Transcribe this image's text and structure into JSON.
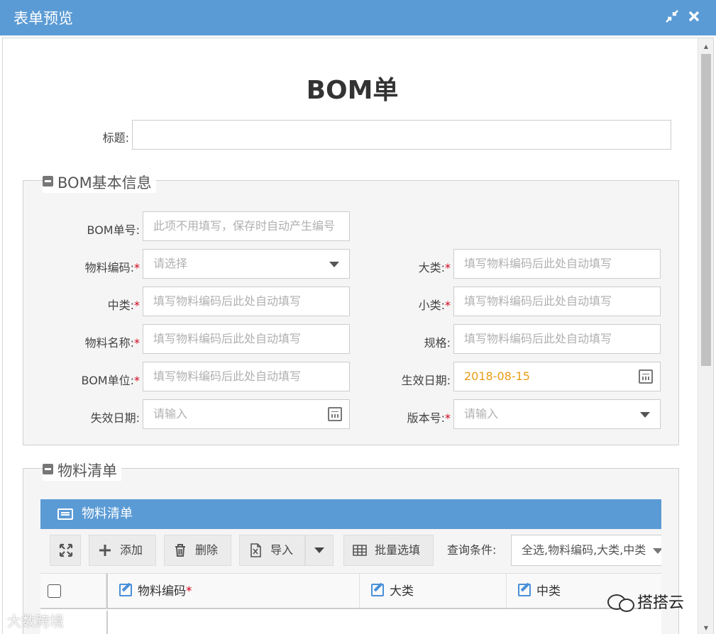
{
  "window": {
    "title": "表单预览"
  },
  "form": {
    "heading": "BOM单",
    "title_label": "标题:",
    "title_value": ""
  },
  "basic_section": {
    "legend": "BOM基本信息",
    "fields": {
      "bom_no": {
        "label": "BOM单号:",
        "placeholder": "此项不用填写，保存时自动产生编号"
      },
      "material_code": {
        "label": "物料编码:",
        "required": "*",
        "value": "请选择"
      },
      "category_l": {
        "label": "大类:",
        "required": "*",
        "placeholder": "填写物料编码后此处自动填写"
      },
      "category_m": {
        "label": "中类:",
        "required": "*",
        "placeholder": "填写物料编码后此处自动填写"
      },
      "category_s": {
        "label": "小类:",
        "required": "*",
        "placeholder": "填写物料编码后此处自动填写"
      },
      "material_name": {
        "label": "物料名称:",
        "required": "*",
        "placeholder": "填写物料编码后此处自动填写"
      },
      "spec": {
        "label": "规格:",
        "placeholder": "填写物料编码后此处自动填写"
      },
      "bom_unit": {
        "label": "BOM单位:",
        "required": "*",
        "placeholder": "填写物料编码后此处自动填写"
      },
      "effective_date": {
        "label": "生效日期:",
        "value": "2018-08-15"
      },
      "expiry_date": {
        "label": "失效日期:",
        "placeholder": "请输入"
      },
      "version": {
        "label": "版本号:",
        "required": "*",
        "placeholder": "请输入"
      }
    }
  },
  "material_section": {
    "legend": "物料清单",
    "grid_title": "物料清单",
    "toolbar": {
      "add": "添加",
      "delete": "删除",
      "import": "导入",
      "batch_fill": "批量选填",
      "query_label": "查询条件:",
      "query_value": "全选,物料编码,大类,中类"
    },
    "columns": [
      {
        "label": "物料编码",
        "required": "*"
      },
      {
        "label": "大类",
        "required": ""
      },
      {
        "label": "中类",
        "required": ""
      }
    ]
  },
  "watermarks": {
    "left": "大数跨境",
    "right": "搭搭云"
  },
  "icons": {
    "titlebar": [
      "minimize-icon",
      "close-icon"
    ],
    "fieldset": "collapse-minus-icon",
    "grid_header": "list-icon",
    "toolbar": [
      "expand-icon",
      "plus-icon",
      "trash-icon",
      "excel-icon",
      "chevron-down-icon",
      "grid-icon"
    ],
    "columns": "edit-icon",
    "date": "calendar-icon"
  },
  "colors": {
    "header_blue": "#5b9bd5",
    "required_red": "#d0021b",
    "date_orange": "#e99d18"
  }
}
